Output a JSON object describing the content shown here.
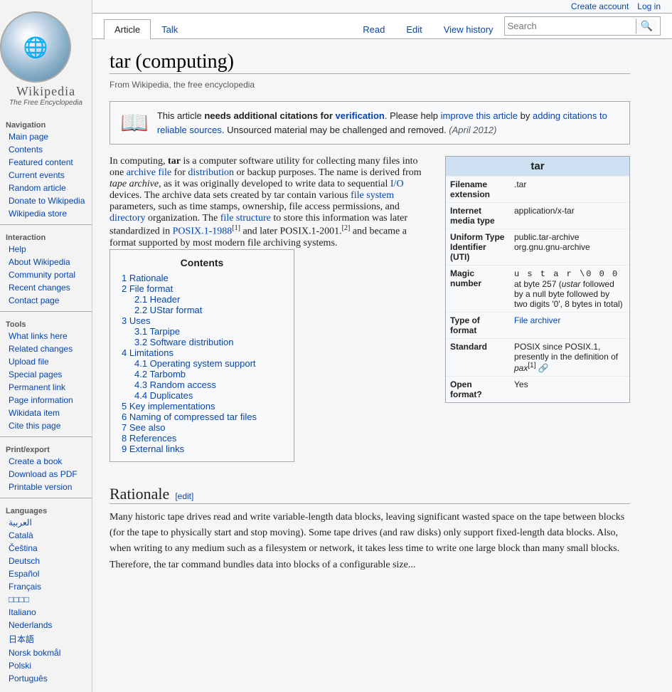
{
  "topnav": {
    "create_account": "Create account",
    "log_in": "Log in"
  },
  "tabs": {
    "article": "Article",
    "talk": "Talk",
    "read": "Read",
    "edit": "Edit",
    "view_history": "View history"
  },
  "search": {
    "placeholder": "Search",
    "button": "🔍"
  },
  "sidebar": {
    "logo_text": "🌐",
    "wordmark": "Wikipedia",
    "tagline": "The Free Encyclopedia",
    "navigation": {
      "title": "Navigation",
      "items": [
        {
          "label": "Main page",
          "href": "#"
        },
        {
          "label": "Contents",
          "href": "#"
        },
        {
          "label": "Featured content",
          "href": "#"
        },
        {
          "label": "Current events",
          "href": "#"
        },
        {
          "label": "Random article",
          "href": "#"
        },
        {
          "label": "Donate to Wikipedia",
          "href": "#"
        },
        {
          "label": "Wikipedia store",
          "href": "#"
        }
      ]
    },
    "interaction": {
      "title": "Interaction",
      "items": [
        {
          "label": "Help",
          "href": "#"
        },
        {
          "label": "About Wikipedia",
          "href": "#"
        },
        {
          "label": "Community portal",
          "href": "#"
        },
        {
          "label": "Recent changes",
          "href": "#"
        },
        {
          "label": "Contact page",
          "href": "#"
        }
      ]
    },
    "tools": {
      "title": "Tools",
      "items": [
        {
          "label": "What links here",
          "href": "#"
        },
        {
          "label": "Related changes",
          "href": "#"
        },
        {
          "label": "Upload file",
          "href": "#"
        },
        {
          "label": "Special pages",
          "href": "#"
        },
        {
          "label": "Permanent link",
          "href": "#"
        },
        {
          "label": "Page information",
          "href": "#"
        },
        {
          "label": "Wikidata item",
          "href": "#"
        },
        {
          "label": "Cite this page",
          "href": "#"
        }
      ]
    },
    "print": {
      "title": "Print/export",
      "items": [
        {
          "label": "Create a book",
          "href": "#"
        },
        {
          "label": "Download as PDF",
          "href": "#"
        },
        {
          "label": "Printable version",
          "href": "#"
        }
      ]
    },
    "languages": {
      "title": "Languages",
      "items": [
        {
          "label": "العربية"
        },
        {
          "label": "Català"
        },
        {
          "label": "Čeština"
        },
        {
          "label": "Deutsch"
        },
        {
          "label": "Español"
        },
        {
          "label": "Français"
        },
        {
          "label": "日本語"
        },
        {
          "label": "Italiano"
        },
        {
          "label": "Nederlands"
        },
        {
          "label": "日本語"
        },
        {
          "label": "Norsk bokmål"
        },
        {
          "label": "Polski"
        },
        {
          "label": "Português"
        }
      ]
    }
  },
  "article": {
    "title": "tar (computing)",
    "subtitle": "From Wikipedia, the free encyclopedia",
    "notice": {
      "icon": "📖",
      "text_parts": [
        "This article ",
        "needs additional citations for ",
        "verification",
        ". Please help ",
        "improve this article",
        " by ",
        "adding citations to reliable sources",
        ". Unsourced material may be challenged and removed. ",
        "(April 2012)"
      ]
    },
    "intro": "In computing, tar is a computer software utility for collecting many files into one archive file for distribution or backup purposes. The name is derived from tape archive, as it was originally developed to write data to sequential I/O devices. The archive data sets created by tar contain various file system parameters, such as time stamps, ownership, file access permissions, and directory organization. The file structure to store this information was later standardized in POSIX.1-1988[1] and later POSIX.1-2001.[2] and became a format supported by most modern file archiving systems.",
    "infobox": {
      "title": "tar",
      "rows": [
        {
          "label": "Filename extension",
          "value": ".tar"
        },
        {
          "label": "Internet media type",
          "value": "application/x-tar"
        },
        {
          "label": "Uniform Type Identifier (UTI)",
          "value": "public.tar-archive org.gnu.gnu-archive"
        },
        {
          "label": "Magic number",
          "value": "u s t a r \\0 0 0 at byte 257 (ustar followed by a null byte followed by two digits '0', 8 bytes in total)"
        },
        {
          "label": "Type of format",
          "value": "File archiver"
        },
        {
          "label": "Standard",
          "value": "POSIX since POSIX.1, presently in the definition of pax[1]"
        },
        {
          "label": "Open format?",
          "value": "Yes"
        }
      ]
    },
    "contents": {
      "title": "Contents",
      "items": [
        {
          "num": "1",
          "label": "Rationale",
          "sub": []
        },
        {
          "num": "2",
          "label": "File format",
          "sub": [
            {
              "num": "2.1",
              "label": "Header"
            },
            {
              "num": "2.2",
              "label": "UStar format"
            }
          ]
        },
        {
          "num": "3",
          "label": "Uses",
          "sub": [
            {
              "num": "3.1",
              "label": "Tarpipe"
            },
            {
              "num": "3.2",
              "label": "Software distribution"
            }
          ]
        },
        {
          "num": "4",
          "label": "Limitations",
          "sub": [
            {
              "num": "4.1",
              "label": "Operating system support"
            },
            {
              "num": "4.2",
              "label": "Tarbomb"
            },
            {
              "num": "4.3",
              "label": "Random access"
            },
            {
              "num": "4.4",
              "label": "Duplicates"
            }
          ]
        },
        {
          "num": "5",
          "label": "Key implementations",
          "sub": []
        },
        {
          "num": "6",
          "label": "Naming of compressed tar files",
          "sub": []
        },
        {
          "num": "7",
          "label": "See also",
          "sub": []
        },
        {
          "num": "8",
          "label": "References",
          "sub": []
        },
        {
          "num": "9",
          "label": "External links",
          "sub": []
        }
      ]
    },
    "rationale": {
      "heading": "Rationale",
      "edit_label": "[edit]",
      "text": "Many historic tape drives read and write variable-length data blocks, leaving significant wasted space on the tape between blocks (for the tape to physically start and stop moving). Some tape drives (and raw disks) only support fixed-length data blocks. Also, when writing to any medium such as a filesystem or network, it takes less time to write one large block than many small blocks. Therefore, the tar command bundles data into blocks of a configurable size..."
    }
  },
  "colors": {
    "link": "#0645ad",
    "sidebar_bg": "#f3f3f3",
    "infobox_header": "#cee0f2",
    "notice_border": "#a2a9b1",
    "tab_active_bg": "#ffffff"
  }
}
